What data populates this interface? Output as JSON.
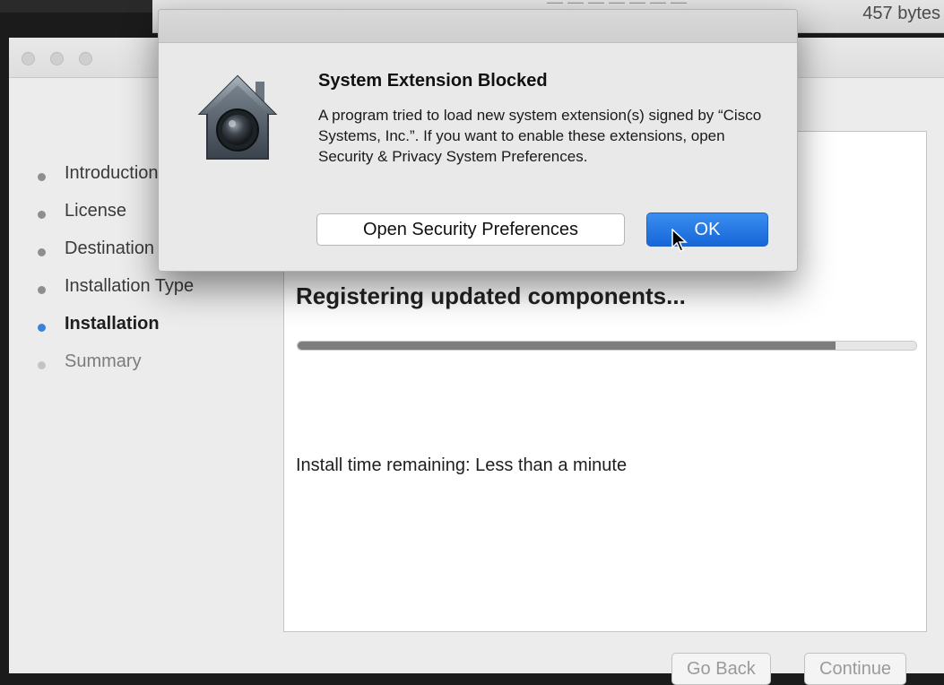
{
  "background_window": {
    "size_text": "457 bytes",
    "faded_header": "— — — — — — —"
  },
  "installer": {
    "steps": [
      {
        "label": "Introduction",
        "state": "done"
      },
      {
        "label": "License",
        "state": "done"
      },
      {
        "label": "Destination Select",
        "state": "done"
      },
      {
        "label": "Installation Type",
        "state": "done"
      },
      {
        "label": "Installation",
        "state": "current"
      },
      {
        "label": "Summary",
        "state": "pending"
      }
    ],
    "status": "Registering updated components...",
    "progress_percent": 87,
    "time_remaining": "Install time remaining: Less than a minute",
    "go_back_label": "Go Back",
    "continue_label": "Continue"
  },
  "dialog": {
    "title": "System Extension Blocked",
    "message": "A program tried to load new system extension(s) signed by “Cisco Systems, Inc.”.  If you want to enable these extensions, open Security & Privacy System Preferences.",
    "open_prefs_label": "Open Security Preferences",
    "ok_label": "OK",
    "icon": "security-house-icon"
  },
  "colors": {
    "accent": "#1766d8",
    "current_step": "#3b83d8"
  }
}
